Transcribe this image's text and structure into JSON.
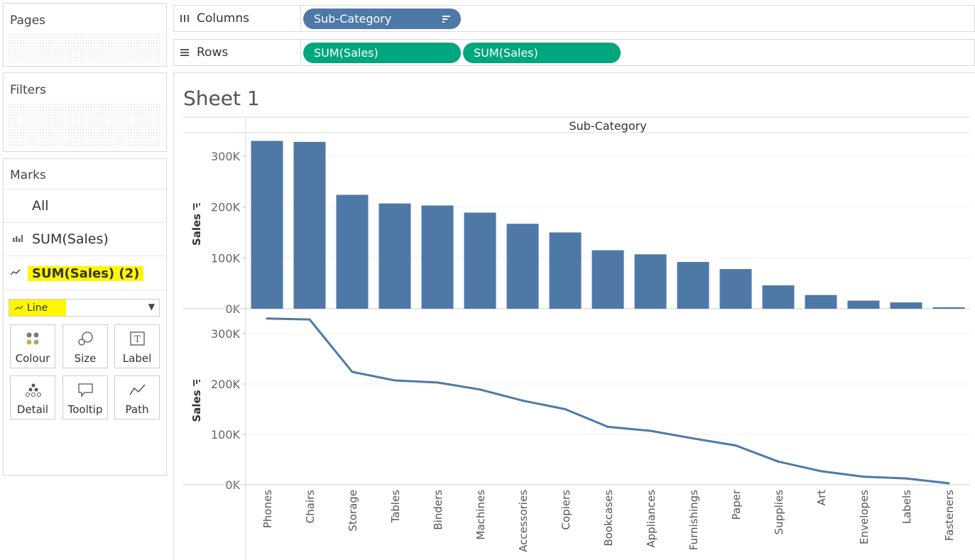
{
  "pages": {
    "title": "Pages"
  },
  "filters": {
    "title": "Filters"
  },
  "marks": {
    "title": "Marks",
    "items": [
      {
        "label": "All",
        "icon": "none"
      },
      {
        "label": "SUM(Sales)",
        "icon": "bar-chart-icon"
      },
      {
        "label": "SUM(Sales) (2)",
        "icon": "line-chart-icon",
        "highlighted": true
      }
    ],
    "mark_type": "Line",
    "buttons": [
      {
        "label": "Colour",
        "icon": "colour-icon"
      },
      {
        "label": "Size",
        "icon": "size-icon"
      },
      {
        "label": "Label",
        "icon": "label-icon"
      },
      {
        "label": "Detail",
        "icon": "detail-icon"
      },
      {
        "label": "Tooltip",
        "icon": "tooltip-icon"
      },
      {
        "label": "Path",
        "icon": "path-icon"
      }
    ],
    "highlight_color": "#fff700"
  },
  "shelves": {
    "columns": {
      "label": "Columns",
      "pills": [
        {
          "text": "Sub-Category",
          "color": "#4e79a7"
        }
      ]
    },
    "rows": {
      "label": "Rows",
      "pills": [
        {
          "text": "SUM(Sales)",
          "color": "#00a67e"
        },
        {
          "text": "SUM(Sales)",
          "color": "#00a67e"
        }
      ]
    }
  },
  "sheet": {
    "title": "Sheet 1"
  },
  "chart_data": {
    "type": "bar",
    "header": "Sub-Category",
    "categories": [
      "Phones",
      "Chairs",
      "Storage",
      "Tables",
      "Binders",
      "Machines",
      "Accessories",
      "Copiers",
      "Bookcases",
      "Appliances",
      "Furnishings",
      "Paper",
      "Supplies",
      "Art",
      "Envelopes",
      "Labels",
      "Fasteners"
    ],
    "series": [
      {
        "type": "bar",
        "values": [
          330000,
          328000,
          224000,
          207000,
          203000,
          189000,
          167000,
          150000,
          115000,
          107000,
          92000,
          78000,
          46000,
          27000,
          16000,
          12500,
          3000
        ],
        "color": "#4e79a7"
      },
      {
        "type": "line",
        "values": [
          330000,
          328000,
          224000,
          207000,
          203000,
          189000,
          167000,
          150000,
          115000,
          107000,
          92000,
          78000,
          46000,
          27000,
          16000,
          12500,
          3000
        ],
        "color": "#4e79a7"
      }
    ],
    "ylabel": "Sales",
    "yticks": [
      0,
      100000,
      200000,
      300000
    ],
    "ytick_labels": [
      "0K",
      "100K",
      "200K",
      "300K"
    ],
    "ylim": [
      0,
      340000
    ],
    "grid": true
  }
}
